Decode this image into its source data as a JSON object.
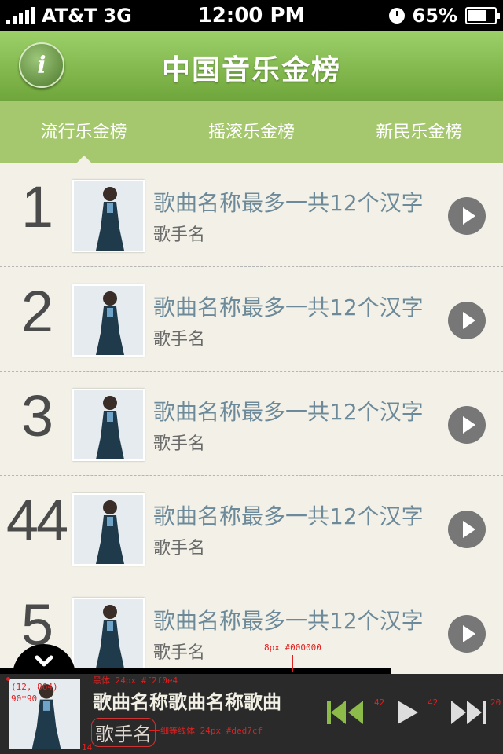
{
  "status_bar": {
    "carrier": "AT&T",
    "network": "3G",
    "time": "12:00 PM",
    "battery": "65%"
  },
  "header": {
    "info_icon": "i",
    "title": "中国音乐金榜"
  },
  "tabs": [
    {
      "label": "流行乐金榜",
      "active": true
    },
    {
      "label": "摇滚乐金榜"
    },
    {
      "label": "新民乐金榜"
    }
  ],
  "chart_list": [
    {
      "rank": "1",
      "song": "歌曲名称最多一共12个汉字",
      "artist": "歌手名"
    },
    {
      "rank": "2",
      "song": "歌曲名称最多一共12个汉字",
      "artist": "歌手名"
    },
    {
      "rank": "3",
      "song": "歌曲名称最多一共12个汉字",
      "artist": "歌手名"
    },
    {
      "rank": "44",
      "song": "歌曲名称最多一共12个汉字",
      "artist": "歌手名"
    },
    {
      "rank": "5",
      "song": "歌曲名称最多一共12个汉字",
      "artist": "歌手名"
    }
  ],
  "player": {
    "song": "歌曲名称歌曲名称歌曲",
    "artist": "歌手名"
  },
  "annotations": {
    "top_line": "8px #000000",
    "title_font": "黑体 24px #f2f0e4",
    "coords": "(12, 864)",
    "size": "90*90",
    "artist_font": "细等线体 24px #ded7cf",
    "gap1": "42",
    "gap2": "42",
    "gap3": "20",
    "bottom_margin": "14"
  },
  "colors": {
    "header_green": "#7fb24a",
    "tab_green": "#a5c86e",
    "list_bg": "#f3f1e7",
    "song_text": "#6d8a9a",
    "player_bg": "#2a2a2a"
  }
}
